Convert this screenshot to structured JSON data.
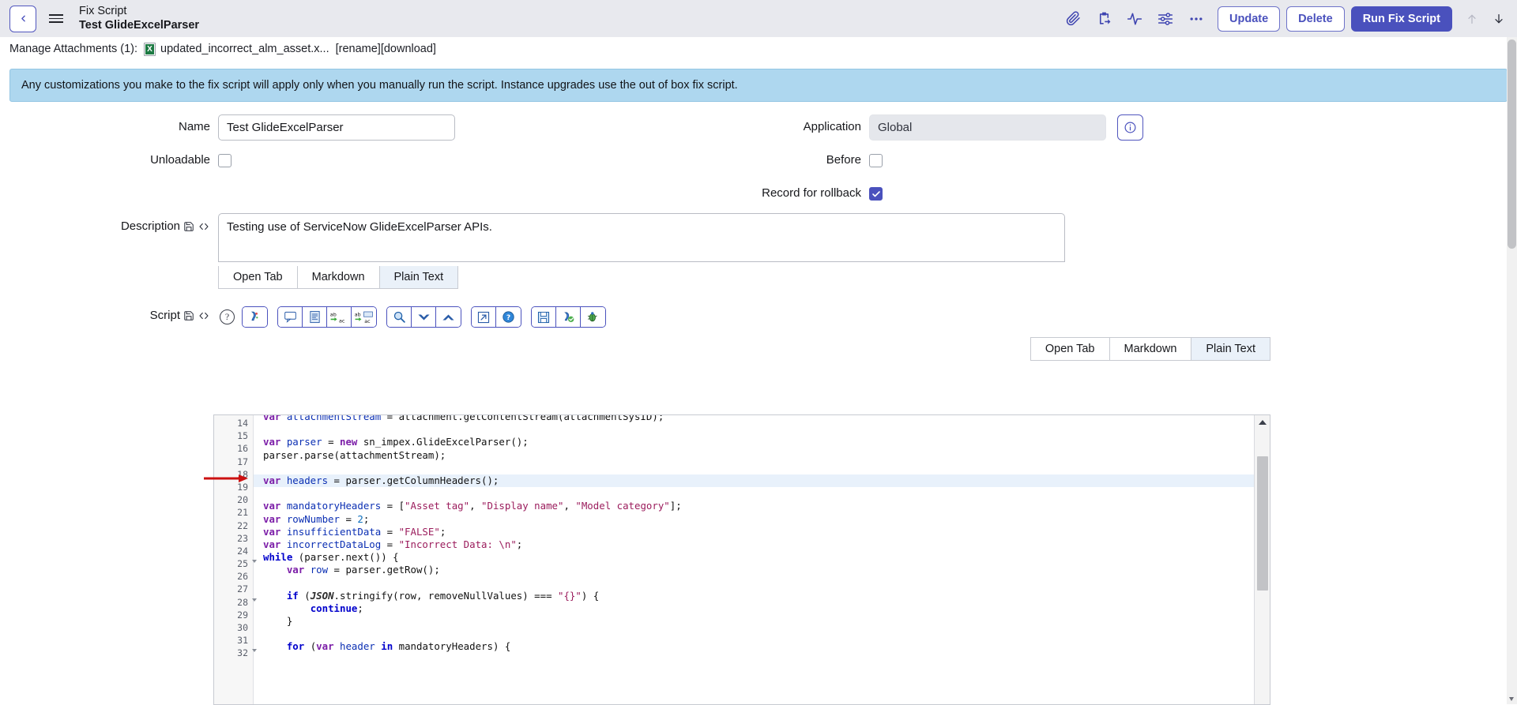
{
  "header": {
    "back_icon": "chevron-left-icon",
    "menu_icon": "hamburger-menu-icon",
    "kicker": "Fix Script",
    "title": "Test GlideExcelParser",
    "icons": [
      {
        "name": "attachment-icon",
        "glyph": "paperclip"
      },
      {
        "name": "clipboard-export-icon",
        "glyph": "clipboard"
      },
      {
        "name": "activity-pulse-icon",
        "glyph": "pulse"
      },
      {
        "name": "preferences-sliders-icon",
        "glyph": "sliders"
      },
      {
        "name": "more-options-icon",
        "glyph": "ellipsis"
      }
    ],
    "buttons": {
      "update": "Update",
      "delete": "Delete",
      "run_fix_script": "Run Fix Script"
    },
    "nav": {
      "prev": "up-arrow-icon",
      "next": "down-arrow-icon"
    },
    "colors": {
      "accent": "#4a51bd",
      "bg": "#e8e9ee"
    }
  },
  "attachments": {
    "label": "Manage Attachments (1):",
    "file_icon": "excel-file-icon",
    "file_name": "updated_incorrect_alm_asset.x...",
    "rename": "[rename]",
    "download": "[download]"
  },
  "banner": {
    "text": "Any customizations you make to the fix script will apply only when you manually run the script. Instance upgrades use the out of box fix script.",
    "color": "#aed7ef"
  },
  "form": {
    "name": {
      "label": "Name",
      "value": "Test GlideExcelParser"
    },
    "unloadable": {
      "label": "Unloadable",
      "checked": false
    },
    "application": {
      "label": "Application",
      "value": "Global",
      "info_icon": "info-circle-icon"
    },
    "before": {
      "label": "Before",
      "checked": false
    },
    "record_for_rollback": {
      "label": "Record for rollback",
      "checked": true
    },
    "description": {
      "label": "Description",
      "save_icon": "save-floppy-icon",
      "code_icon": "code-brackets-icon",
      "value": "Testing use of ServiceNow GlideExcelParser APIs.",
      "tabs": [
        {
          "label": "Open Tab",
          "active": false
        },
        {
          "label": "Markdown",
          "active": false
        },
        {
          "label": "Plain Text",
          "active": true
        }
      ]
    },
    "script": {
      "label": "Script",
      "save_icon": "save-floppy-icon",
      "code_icon": "code-brackets-icon",
      "help_icon": "question-circle-icon",
      "tabs": [
        {
          "label": "Open Tab",
          "active": false
        },
        {
          "label": "Markdown",
          "active": false
        },
        {
          "label": "Plain Text",
          "active": true
        }
      ],
      "toolbar_groups": [
        [
          {
            "name": "syntax-colorizer-icon"
          }
        ],
        [
          {
            "name": "comment-icon"
          },
          {
            "name": "format-document-icon"
          },
          {
            "name": "replace-text-icon"
          },
          {
            "name": "replace-all-icon"
          }
        ],
        [
          {
            "name": "search-icon"
          },
          {
            "name": "jump-down-icon"
          },
          {
            "name": "jump-up-icon"
          }
        ],
        [
          {
            "name": "open-external-icon"
          },
          {
            "name": "help-blue-icon"
          }
        ],
        [
          {
            "name": "save-icon"
          },
          {
            "name": "syntax-check-icon"
          },
          {
            "name": "debug-bug-icon"
          }
        ]
      ]
    }
  },
  "editor": {
    "highlight_line": 19,
    "annotation_arrow": "red-arrow-pointer",
    "lines": [
      {
        "n": 14,
        "fold": false,
        "partial": true,
        "tokens": [
          {
            "t": "var ",
            "c": "kw"
          },
          {
            "t": "attachmentStream",
            "c": "varname"
          },
          {
            "t": " = attachment.getContentStream(attachmentSysID);",
            "c": "plain"
          }
        ]
      },
      {
        "n": 15,
        "fold": false,
        "tokens": []
      },
      {
        "n": 16,
        "fold": false,
        "tokens": [
          {
            "t": "var ",
            "c": "kw"
          },
          {
            "t": "parser",
            "c": "varname"
          },
          {
            "t": " = ",
            "c": "plain"
          },
          {
            "t": "new ",
            "c": "kw"
          },
          {
            "t": "sn_impex.GlideExcelParser();",
            "c": "plain"
          }
        ]
      },
      {
        "n": 17,
        "fold": false,
        "tokens": [
          {
            "t": "parser.parse(attachmentStream);",
            "c": "plain"
          }
        ]
      },
      {
        "n": 18,
        "fold": false,
        "tokens": []
      },
      {
        "n": 19,
        "fold": false,
        "tokens": [
          {
            "t": "var ",
            "c": "kw"
          },
          {
            "t": "headers",
            "c": "varname"
          },
          {
            "t": " = parser.getColumnHeaders();",
            "c": "plain"
          }
        ]
      },
      {
        "n": 20,
        "fold": false,
        "tokens": []
      },
      {
        "n": 21,
        "fold": false,
        "tokens": [
          {
            "t": "var ",
            "c": "kw"
          },
          {
            "t": "mandatoryHeaders",
            "c": "varname"
          },
          {
            "t": " = [",
            "c": "plain"
          },
          {
            "t": "\"Asset tag\"",
            "c": "str"
          },
          {
            "t": ", ",
            "c": "plain"
          },
          {
            "t": "\"Display name\"",
            "c": "str"
          },
          {
            "t": ", ",
            "c": "plain"
          },
          {
            "t": "\"Model category\"",
            "c": "str"
          },
          {
            "t": "];",
            "c": "plain"
          }
        ]
      },
      {
        "n": 22,
        "fold": false,
        "tokens": [
          {
            "t": "var ",
            "c": "kw"
          },
          {
            "t": "rowNumber",
            "c": "varname"
          },
          {
            "t": " = ",
            "c": "plain"
          },
          {
            "t": "2",
            "c": "num"
          },
          {
            "t": ";",
            "c": "plain"
          }
        ]
      },
      {
        "n": 23,
        "fold": false,
        "tokens": [
          {
            "t": "var ",
            "c": "kw"
          },
          {
            "t": "insufficientData",
            "c": "varname"
          },
          {
            "t": " = ",
            "c": "plain"
          },
          {
            "t": "\"FALSE\"",
            "c": "str"
          },
          {
            "t": ";",
            "c": "plain"
          }
        ]
      },
      {
        "n": 24,
        "fold": false,
        "tokens": [
          {
            "t": "var ",
            "c": "kw"
          },
          {
            "t": "incorrectDataLog",
            "c": "varname"
          },
          {
            "t": " = ",
            "c": "plain"
          },
          {
            "t": "\"Incorrect Data: \\n\"",
            "c": "str"
          },
          {
            "t": ";",
            "c": "plain"
          }
        ]
      },
      {
        "n": 25,
        "fold": true,
        "tokens": [
          {
            "t": "while",
            "c": "kw2"
          },
          {
            "t": " (parser.next()) {",
            "c": "plain"
          }
        ]
      },
      {
        "n": 26,
        "fold": false,
        "tokens": [
          {
            "t": "    ",
            "c": "plain"
          },
          {
            "t": "var ",
            "c": "kw"
          },
          {
            "t": "row",
            "c": "varname"
          },
          {
            "t": " = parser.getRow();",
            "c": "plain"
          }
        ]
      },
      {
        "n": 27,
        "fold": false,
        "tokens": []
      },
      {
        "n": 28,
        "fold": true,
        "tokens": [
          {
            "t": "    ",
            "c": "plain"
          },
          {
            "t": "if",
            "c": "kw2"
          },
          {
            "t": " (",
            "c": "plain"
          },
          {
            "t": "JSON",
            "c": "json"
          },
          {
            "t": ".stringify(row, removeNullValues) === ",
            "c": "plain"
          },
          {
            "t": "\"{}\"",
            "c": "str"
          },
          {
            "t": ") {",
            "c": "plain"
          }
        ]
      },
      {
        "n": 29,
        "fold": false,
        "tokens": [
          {
            "t": "        ",
            "c": "plain"
          },
          {
            "t": "continue",
            "c": "kw2"
          },
          {
            "t": ";",
            "c": "plain"
          }
        ]
      },
      {
        "n": 30,
        "fold": false,
        "tokens": [
          {
            "t": "    }",
            "c": "plain"
          }
        ]
      },
      {
        "n": 31,
        "fold": false,
        "tokens": []
      },
      {
        "n": 32,
        "fold": true,
        "tokens": [
          {
            "t": "    ",
            "c": "plain"
          },
          {
            "t": "for",
            "c": "kw2"
          },
          {
            "t": " (",
            "c": "plain"
          },
          {
            "t": "var ",
            "c": "kw"
          },
          {
            "t": "header",
            "c": "varname"
          },
          {
            "t": " ",
            "c": "plain"
          },
          {
            "t": "in",
            "c": "kw2"
          },
          {
            "t": " mandatoryHeaders) {",
            "c": "plain"
          }
        ]
      }
    ]
  }
}
